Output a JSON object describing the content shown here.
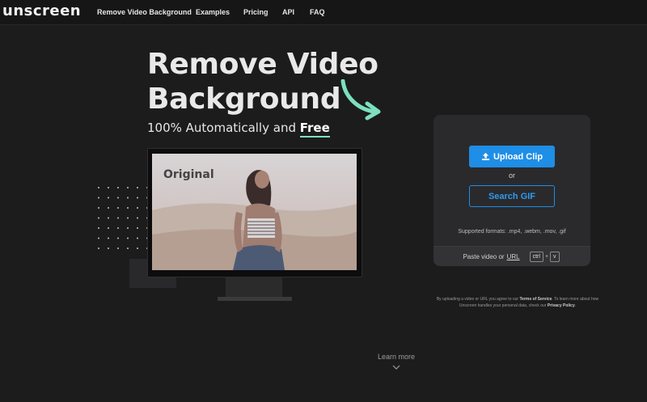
{
  "nav": {
    "logo": "unscreen",
    "items": [
      {
        "label": "Remove Video Background"
      },
      {
        "label": "Examples"
      },
      {
        "label": "Pricing"
      },
      {
        "label": "API"
      },
      {
        "label": "FAQ"
      }
    ]
  },
  "hero": {
    "title_line1": "Remove Video",
    "title_line2": "Background",
    "subtitle_prefix": "100% Automatically and ",
    "subtitle_free": "Free",
    "preview_label": "Original"
  },
  "upload": {
    "upload_label": "Upload Clip",
    "or_label": "or",
    "search_gif_label": "Search GIF",
    "formats": "Supported formats: .mp4, .webm, .mov, .gif",
    "paste_text": "Paste video or",
    "paste_url": "URL",
    "key_ctrl": "ctrl",
    "key_plus": "+",
    "key_v": "v"
  },
  "terms": {
    "part1": "By uploading a video or URL you agree to our ",
    "terms_link": "Terms of Service",
    "part2": ". To learn more about how Unscreen handles your personal data, check our ",
    "privacy_link": "Privacy Policy",
    "part3": "."
  },
  "footer": {
    "learn_more": "Learn more"
  },
  "colors": {
    "background": "#1c1c1d",
    "accent_blue": "#1e8ee6",
    "accent_green": "#7ce0be",
    "card": "#2a2a2c"
  },
  "icons": [
    "upload-icon",
    "curved-arrow-icon",
    "chevron-down-icon"
  ]
}
